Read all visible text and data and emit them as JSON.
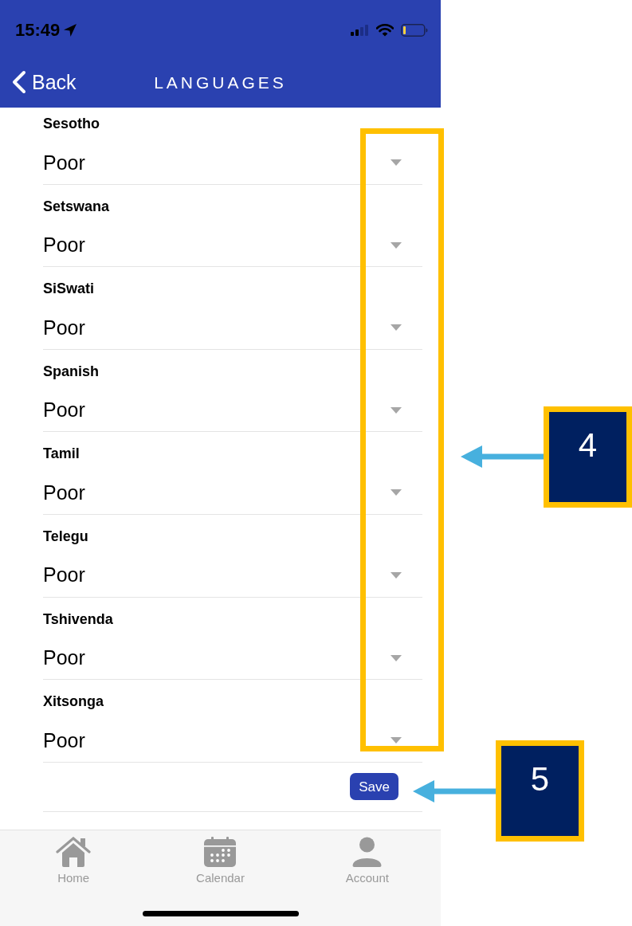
{
  "status_bar": {
    "time": "15:49"
  },
  "nav_bar": {
    "back": "Back",
    "title": "LANGUAGES"
  },
  "languages": [
    {
      "name": "Sesotho",
      "proficiency": "Poor"
    },
    {
      "name": "Setswana",
      "proficiency": "Poor"
    },
    {
      "name": "SiSwati",
      "proficiency": "Poor"
    },
    {
      "name": "Spanish",
      "proficiency": "Poor"
    },
    {
      "name": "Tamil",
      "proficiency": "Poor"
    },
    {
      "name": "Telegu",
      "proficiency": "Poor"
    },
    {
      "name": "Tshivenda",
      "proficiency": "Poor"
    },
    {
      "name": "Xitsonga",
      "proficiency": "Poor"
    }
  ],
  "save_button": "Save",
  "tab_bar": [
    {
      "label": "Home",
      "kind": "home"
    },
    {
      "label": "Calendar",
      "kind": "calendar"
    },
    {
      "label": "Account",
      "kind": "account"
    }
  ],
  "callouts": [
    {
      "number": "4",
      "highlight": true
    },
    {
      "number": "5",
      "highlight": false
    }
  ]
}
